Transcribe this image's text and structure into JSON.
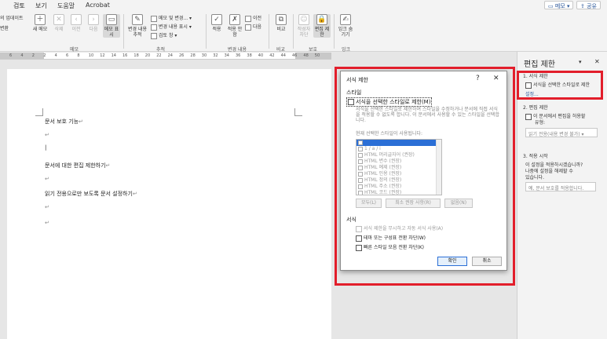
{
  "tabs": {
    "t1": "검토",
    "t2": "보기",
    "t3": "도움말",
    "t4": "Acrobat"
  },
  "top_right": {
    "memo": "메모",
    "share": "공유"
  },
  "ribbon": {
    "left_edge_1": "의 업데이트",
    "left_edge_2": "변환",
    "new_comment": "새 메모",
    "delete": "삭제",
    "prev": "이전",
    "next": "다음",
    "show_comments": "메모 표시",
    "track_changes": "변경 내용 추적",
    "markup_row1": "메모 및 변경...",
    "markup_row2": "변경 내용 표시",
    "markup_row3": "검토 창",
    "accept": "적용",
    "reject": "적용 안 함",
    "prev2": "이전",
    "next2": "다음",
    "compare": "비교",
    "block_authors": "작성자 차단",
    "restrict_editing": "편집 제한",
    "hide_ink": "잉크 숨기기",
    "group_memo": "메모",
    "group_tracking": "추적",
    "group_changes": "변경 내용",
    "group_compare": "비교",
    "group_protect": "보호",
    "group_ink": "잉크"
  },
  "ruler": {
    "numbers": [
      "6",
      "4",
      "2",
      "2",
      "4",
      "6",
      "8",
      "10",
      "12",
      "14",
      "16",
      "18",
      "20",
      "22",
      "24",
      "26",
      "28",
      "30",
      "32",
      "34",
      "36",
      "38",
      "40",
      "42",
      "44",
      "46",
      "48",
      "50"
    ]
  },
  "document": {
    "line1": "문서 보호 기능",
    "line2": "문서에 대한 편집 제한하기",
    "line3": "읽기 전용으로만 보도록 문서 설정하기",
    "para_mark": "↵"
  },
  "dialog": {
    "title": "서식 제한",
    "help": "?",
    "close": "✕",
    "style_heading": "스타일",
    "limit_checkbox": "서식을 선택한 스타일로 제한(M)",
    "description": "서식을 선택한 스타일로 제한하여 스타일을 수정하거나 문서에 직접 서식을 적용할 수 없도록 합니다. 이 문서에서 사용할 수 있는 스타일을 선택합니다.",
    "list_label": "현재 선택한 스타일이 사용됩니다:",
    "styles": [
      "",
      "1 / a / i",
      "HTML 머리글자어 (권장)",
      "HTML 변수 (권장)",
      "HTML 예제 (권장)",
      "HTML 인용 (권장)",
      "HTML 정의 (권장)",
      "HTML 주소 (권장)",
      "HTML 코드 (권장)"
    ],
    "btn_all": "모두(L)",
    "btn_recommended": "최소 권장 사항(R)",
    "btn_none": "없음(N)",
    "format_heading": "서식",
    "opt1": "서식 제한을 무시하고 자동 서식 사용(A)",
    "opt2": "테마 또는 구성표 전환 차단(W)",
    "opt3": "빠른 스타일 모음 전환 차단(K)",
    "ok": "확인",
    "cancel": "취소"
  },
  "pane": {
    "title": "편집 제한",
    "s1_heading": "1. 서식 제한",
    "s1_check": "서식을 선택한 스타일로 제한",
    "s1_link": "설정...",
    "s2_heading": "2. 편집 제한",
    "s2_check": "이 문서에서 편집을 허용할",
    "s2_check2": "유형:",
    "s2_select": "읽기 전용(내용 변경 불가)",
    "s3_heading": "3. 적용 시작",
    "s3_text1": "이 설정을 적용하시겠습니까?",
    "s3_text2": "나중에 설정을 해제할 수",
    "s3_text3": "있습니다.",
    "s3_button": "예, 문서 보호를 적용합니다."
  },
  "colors": {
    "highlight": "#e21e2b",
    "accent": "#2b579a",
    "selection": "#2b6fd6"
  }
}
